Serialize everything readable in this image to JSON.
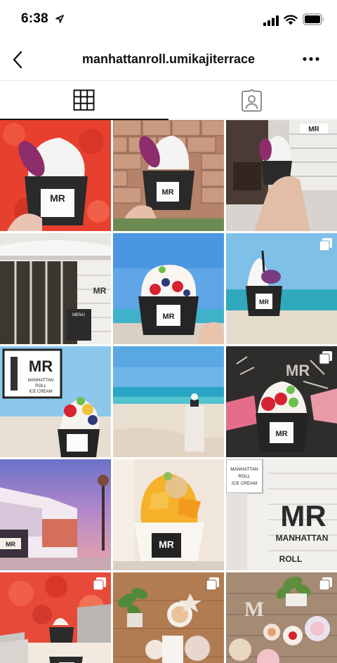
{
  "status_bar": {
    "time": "6:38",
    "icons": [
      "location-arrow-icon",
      "cellular-signal-icon",
      "wifi-icon",
      "battery-icon"
    ]
  },
  "header": {
    "username": "manhattanroll.umikajiterrace",
    "back_icon": "chevron-left-icon",
    "more_icon": "more-horizontal-icon"
  },
  "tabs": [
    {
      "name": "grid",
      "icon": "grid-icon",
      "active": true
    },
    {
      "name": "tagged",
      "icon": "tagged-person-icon",
      "active": false
    }
  ],
  "colors": {
    "active_tab": "#111111",
    "divider": "#e6e6e6",
    "text": "#111111"
  },
  "posts": [
    {
      "subject": "ice cream cup on red backdrop",
      "multiple": false
    },
    {
      "subject": "ice cream cup against stone wall",
      "multiple": false
    },
    {
      "subject": "ice cream cup at shop front",
      "multiple": false
    },
    {
      "subject": "shop exterior",
      "multiple": false
    },
    {
      "subject": "berry parfait by the sea",
      "multiple": false
    },
    {
      "subject": "ice cream at the beach",
      "multiple": true
    },
    {
      "subject": "logo sign with parfait",
      "multiple": false
    },
    {
      "subject": "beach and ocean",
      "multiple": false
    },
    {
      "subject": "parfait on chalkboard",
      "multiple": true
    },
    {
      "subject": "terrace building at dusk",
      "multiple": false
    },
    {
      "subject": "mango shaved ice",
      "multiple": false
    },
    {
      "subject": "shop wall signage",
      "multiple": false
    },
    {
      "subject": "cups on red backdrop",
      "multiple": true
    },
    {
      "subject": "treats on wooden table",
      "multiple": true
    },
    {
      "subject": "desserts with letters",
      "multiple": true
    }
  ],
  "print_labels": {
    "mr": "MR",
    "manhattan": "MANHATTAN",
    "roll": "ROLL",
    "ice_cream": "ICE CREAM",
    "menu": "MENU",
    "menu_on_tile": "MENU"
  }
}
